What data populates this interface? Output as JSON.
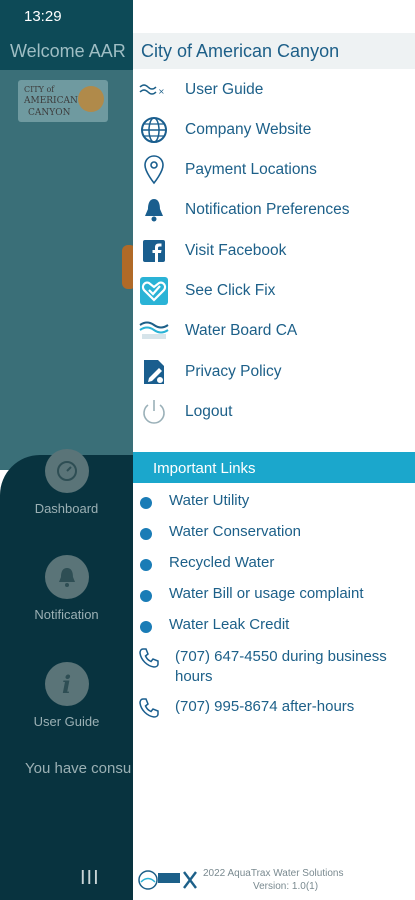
{
  "status_bar": {
    "time": "13:29"
  },
  "background": {
    "welcome": "Welcome AAR",
    "logo": {
      "line1": "CITY of",
      "line2": "AMERICAN",
      "line3": "CANYON"
    },
    "nav": [
      {
        "label": "Dashboard",
        "icon": "gauge-icon"
      },
      {
        "label": "Notification",
        "icon": "bell-icon"
      },
      {
        "label": "User Guide",
        "icon": "info-icon"
      }
    ],
    "consumed_text": "You have consu",
    "navbar_glyph": "III"
  },
  "drawer": {
    "title": "City of American Canyon",
    "menu": [
      {
        "label": "User Guide",
        "icon": "user-guide-logo-icon"
      },
      {
        "label": "Company Website",
        "icon": "globe-icon"
      },
      {
        "label": "Payment Locations",
        "icon": "location-pin-icon"
      },
      {
        "label": "Notification Preferences",
        "icon": "bell-icon"
      },
      {
        "label": "Visit Facebook",
        "icon": "facebook-icon"
      },
      {
        "label": "See Click Fix",
        "icon": "seeclickfix-icon"
      },
      {
        "label": "Water Board CA",
        "icon": "water-board-icon"
      },
      {
        "label": "Privacy Policy",
        "icon": "privacy-icon"
      },
      {
        "label": "Logout",
        "icon": "power-icon"
      }
    ],
    "important_links": {
      "header": "Important Links",
      "items": [
        "Water Utility",
        "Water Conservation",
        "Recycled Water",
        "Water Bill or usage complaint",
        "Water Leak Credit"
      ],
      "phones": [
        "(707) 647-4550 during business hours",
        "(707) 995-8674 after-hours"
      ]
    },
    "footer": {
      "copyright": "2022 AquaTrax Water Solutions",
      "version": "Version: 1.0(1)"
    }
  },
  "colors": {
    "accent": "#1ba7cc",
    "text": "#1d6089",
    "dot": "#1a7cb6"
  }
}
